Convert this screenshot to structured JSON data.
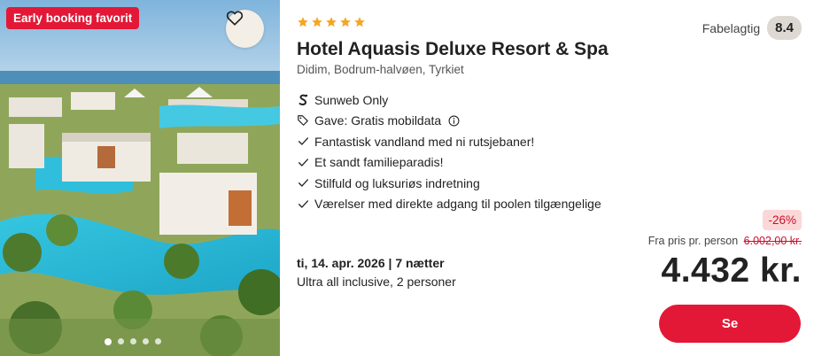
{
  "image": {
    "badge": "Early booking favorit",
    "favorite_icon": "heart-outline-icon",
    "carousel_dots": 5,
    "active_dot": 1
  },
  "hotel": {
    "stars": 5,
    "name": "Hotel Aquasis Deluxe Resort & Spa",
    "location": "Didim, Bodrum-halvøen, Tyrkiet"
  },
  "rating": {
    "label": "Fabelagtig",
    "score": "8.4"
  },
  "features": [
    {
      "icon": "sunweb-logo-icon",
      "text": "Sunweb Only",
      "info": false
    },
    {
      "icon": "tag-icon",
      "text": "Gave: Gratis mobildata",
      "info": true
    },
    {
      "icon": "check-icon",
      "text": "Fantastisk vandland med ni rutsjebaner!",
      "info": false
    },
    {
      "icon": "check-icon",
      "text": "Et sandt familieparadis!",
      "info": false
    },
    {
      "icon": "check-icon",
      "text": "Stilfuld og luksuriøs indretning",
      "info": false
    },
    {
      "icon": "check-icon",
      "text": "Værelser med direkte adgang til poolen tilgængelige",
      "info": false
    }
  ],
  "trip": {
    "dates": "ti, 14. apr. 2026 | 7 nætter",
    "board": "Ultra all inclusive, 2 personer"
  },
  "pricing": {
    "discount": "-26%",
    "from_label": "Fra pris pr. person",
    "old_price": "6.002,00 kr.",
    "price": "4.432 kr."
  },
  "cta": {
    "label": "Se"
  },
  "colors": {
    "brand_red": "#e31837",
    "star_orange": "#f5a623",
    "discount_bg": "#fcd7d7"
  }
}
